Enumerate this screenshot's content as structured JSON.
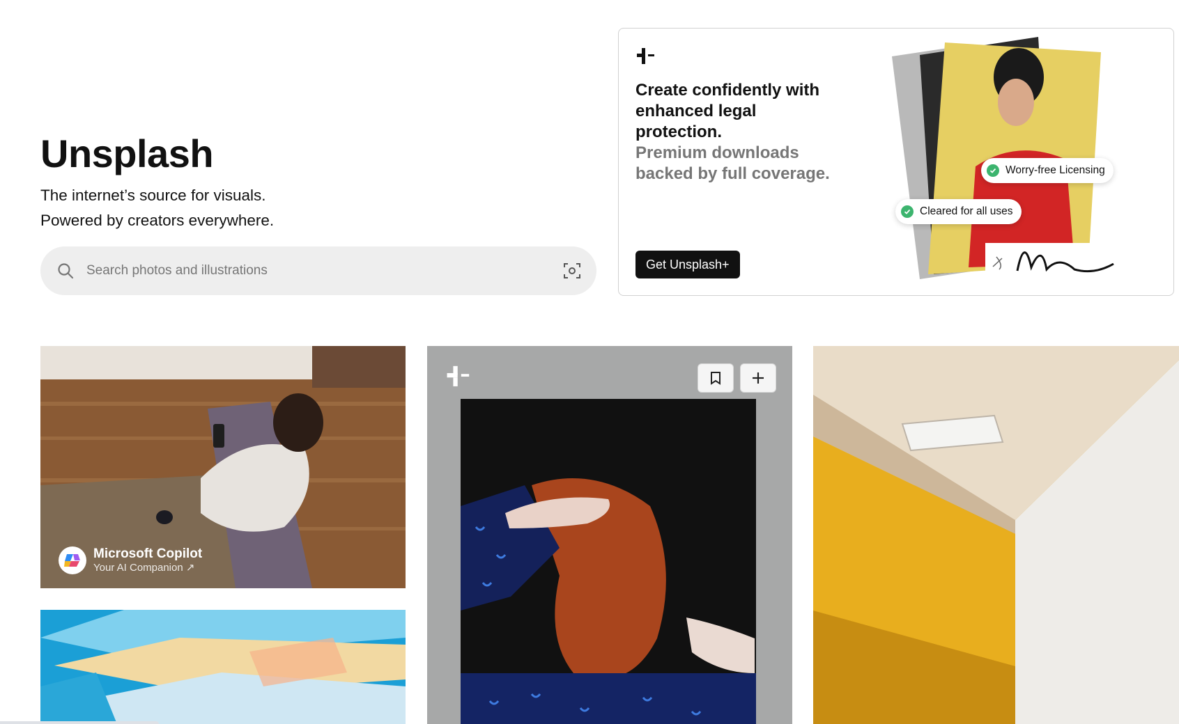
{
  "hero": {
    "title": "Unsplash",
    "subtitle_line1": "The internet’s source for visuals.",
    "subtitle_line2": "Powered by creators everywhere."
  },
  "search": {
    "placeholder": "Search photos and illustrations",
    "search_icon": "search-icon",
    "visual_search_icon": "visual-search-icon"
  },
  "promo": {
    "logo_icon": "unsplash-plus-icon",
    "headline": "Create confidently with enhanced legal protection.",
    "subline": "Premium downloads backed by full coverage.",
    "cta_label": "Get Unsplash+",
    "badges": [
      "Worry-free Licensing",
      "Cleared for all uses"
    ]
  },
  "grid": {
    "sponsored": {
      "name": "Microsoft Copilot",
      "tagline": "Your AI Companion ↗"
    },
    "plus_photo": {
      "bookmark_icon": "bookmark-icon",
      "add_icon": "plus-icon"
    }
  },
  "colors": {
    "accent": "#111111",
    "muted_text": "#767676",
    "search_bg": "#eeeeee",
    "check_green": "#3cb46e"
  }
}
